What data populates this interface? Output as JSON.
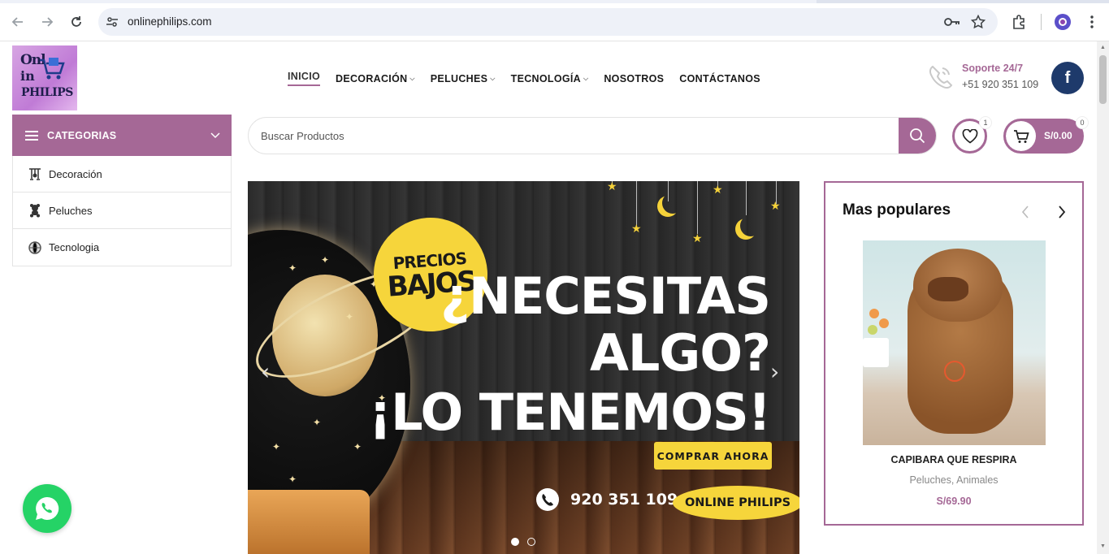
{
  "browser": {
    "url": "onlinephilips.com"
  },
  "header": {
    "logo_text_top": "Onl",
    "logo_text_mid": "in",
    "logo_text_bottom": "PHILIPS",
    "nav": [
      {
        "label": "INICIO",
        "dropdown": false,
        "active": true
      },
      {
        "label": "DECORACIÓN",
        "dropdown": true
      },
      {
        "label": "PELUCHES",
        "dropdown": true
      },
      {
        "label": "TECNOLOGÍA",
        "dropdown": true
      },
      {
        "label": "NOSOTROS",
        "dropdown": false
      },
      {
        "label": "CONTÁCTANOS",
        "dropdown": false
      }
    ],
    "support_title": "Soporte 24/7",
    "support_phone": "+51 920 351 109",
    "facebook_letter": "f"
  },
  "categories": {
    "title": "CATEGORIAS",
    "items": [
      "Decoración",
      "Peluches",
      "Tecnologia"
    ]
  },
  "search": {
    "placeholder": "Buscar Productos"
  },
  "wishlist": {
    "count": "1"
  },
  "cart": {
    "count": "0",
    "amount": "S/0.00"
  },
  "hero": {
    "badge_line1": "PRECIOS",
    "badge_line2": "BAJOS",
    "line1": "¿NECESITAS",
    "line2": "ALGO?",
    "line3": "¡LO TENEMOS!",
    "cta": "COMPRAR AHORA",
    "phone": "920 351 109",
    "brand": "ONLINE PHILIPS"
  },
  "popular": {
    "title": "Mas populares",
    "product": {
      "name": "CAPIBARA QUE RESPIRA",
      "category": "Peluches, Animales",
      "price": "S/69.90"
    }
  },
  "colors": {
    "accent": "#a56896",
    "facebook": "#1e3a6b",
    "whatsapp": "#25d366",
    "hero_yellow": "#f6d53b"
  }
}
